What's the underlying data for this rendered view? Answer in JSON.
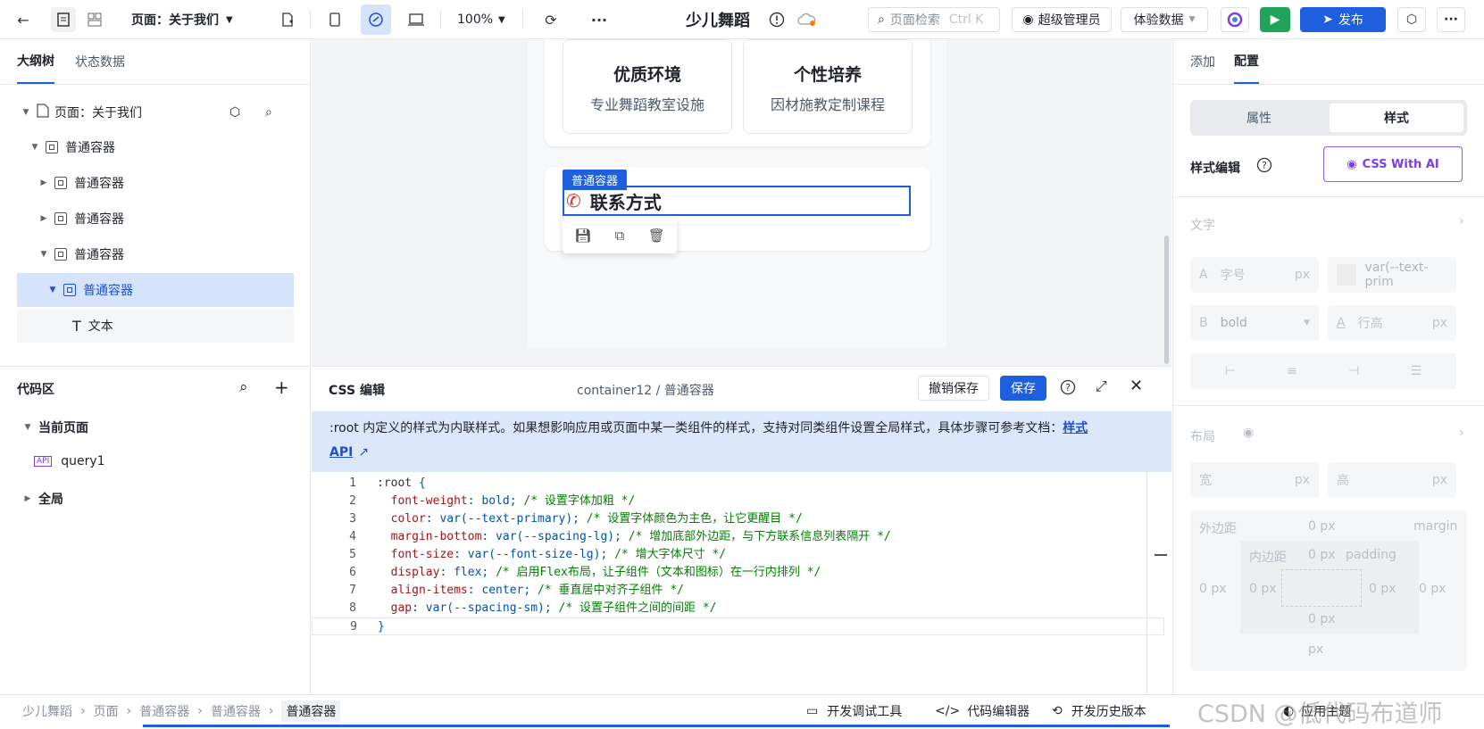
{
  "topbar": {
    "page_selector": "页面：关于我们",
    "zoom": "100%",
    "app_title": "少儿舞蹈",
    "search_placeholder": "页面检索",
    "search_shortcut": "Ctrl K",
    "user_role": "超级管理员",
    "data_mode": "体验数据",
    "publish": "发布"
  },
  "left": {
    "tabs": [
      "大纲树",
      "状态数据"
    ],
    "tree": [
      {
        "label": "页面：关于我们"
      },
      {
        "label": "普通容器"
      },
      {
        "label": "普通容器"
      },
      {
        "label": "普通容器"
      },
      {
        "label": "普通容器"
      },
      {
        "label": "普通容器"
      },
      {
        "label": "文本"
      }
    ],
    "code_title": "代码区",
    "current_page": "当前页面",
    "query_badge": "API",
    "query": "query1",
    "global": "全局"
  },
  "canvas": {
    "features": [
      {
        "title": "优质环境",
        "desc": "专业舞蹈教室设施"
      },
      {
        "title": "个性培养",
        "desc": "因材施教定制课程"
      }
    ],
    "selected_tag": "普通容器",
    "contact_title": "联系方式",
    "contact_icon": "phone-icon"
  },
  "code_panel": {
    "title": "CSS 编辑",
    "path": "container12 / 普通容器",
    "undo_save": "撤销保存",
    "save": "保存",
    "info_text": ":root 内定义的样式为内联样式。如果想影响应用或页面中某一类组件的样式，支持对同类组件设置全局样式，具体步骤可参考文档：",
    "info_link_1": "样式",
    "info_link_2": "API",
    "lines": [
      {
        "n": "1",
        "prop": ":root",
        "val": " {",
        "comment": ""
      },
      {
        "n": "2",
        "prop": "  font-weight",
        "val": ": bold;",
        "comment": " /* 设置字体加粗 */"
      },
      {
        "n": "3",
        "prop": "  color",
        "val": ": var(--text-primary);",
        "comment": " /* 设置字体颜色为主色，让它更醒目 */"
      },
      {
        "n": "4",
        "prop": "  margin-bottom",
        "val": ": var(--spacing-lg);",
        "comment": " /* 增加底部外边距，与下方联系信息列表隔开 */"
      },
      {
        "n": "5",
        "prop": "  font-size",
        "val": ": var(--font-size-lg);",
        "comment": " /* 增大字体尺寸 */"
      },
      {
        "n": "6",
        "prop": "  display",
        "val": ": flex;",
        "comment": " /* 启用Flex布局，让子组件（文本和图标）在一行内排列 */"
      },
      {
        "n": "7",
        "prop": "  align-items",
        "val": ": center;",
        "comment": " /* 垂直居中对齐子组件 */"
      },
      {
        "n": "8",
        "prop": "  gap",
        "val": ": var(--spacing-sm);",
        "comment": " /* 设置子组件之间的间距 */"
      },
      {
        "n": "9",
        "prop": "}",
        "val": "",
        "comment": ""
      }
    ]
  },
  "right": {
    "tabs": [
      "添加",
      "配置"
    ],
    "seg": [
      "属性",
      "样式"
    ],
    "style_edit": "样式编辑",
    "ai_button": "CSS With AI",
    "text_section": "文字",
    "font_size_placeholder": "字号",
    "unit": "px",
    "color_value": "var(--text-prim",
    "weight_value": "bold",
    "line_height_placeholder": "行高",
    "layout_section": "布局",
    "width": "宽",
    "height": "高",
    "margin": "外边距",
    "margin_en": "margin",
    "padding": "内边距",
    "padding_en": "padding",
    "zero": "0 px"
  },
  "status": {
    "crumbs": [
      "少儿舞蹈",
      "页面",
      "普通容器",
      "普通容器",
      "普通容器"
    ],
    "dev_tools": "开发调试工具",
    "code_editor": "代码编辑器",
    "history": "开发历史版本",
    "theme": "应用主题",
    "watermark": "CSDN @低代码布道师"
  }
}
